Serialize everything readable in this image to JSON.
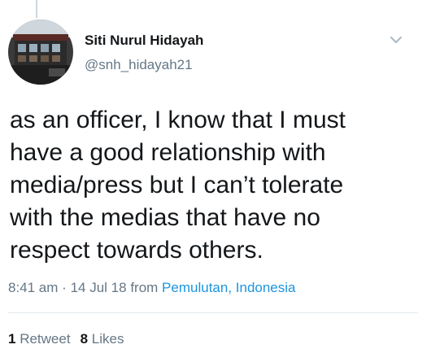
{
  "tweet": {
    "author": {
      "display_name": "Siti Nurul Hidayah",
      "handle": "@snh_hidayah21",
      "avatar_icon": "profile-photo"
    },
    "menu_icon": "chevron-down-icon",
    "text": "as an officer, I know that I must\nhave a good relationship with\nmedia/press but I can’t tolerate\nwith the medias that have no\nrespect towards others.",
    "time": "8:41 am",
    "separator": "·",
    "date": "14 Jul 18",
    "from_label": "from",
    "location": "Pemulutan, Indonesia",
    "retweets": {
      "count": "1",
      "label": "Retweet"
    },
    "likes": {
      "count": "8",
      "label": "Likes"
    }
  },
  "colors": {
    "text": "#14171a",
    "secondary": "#657786",
    "link": "#1b95e0",
    "divider": "#e1e8ed"
  }
}
